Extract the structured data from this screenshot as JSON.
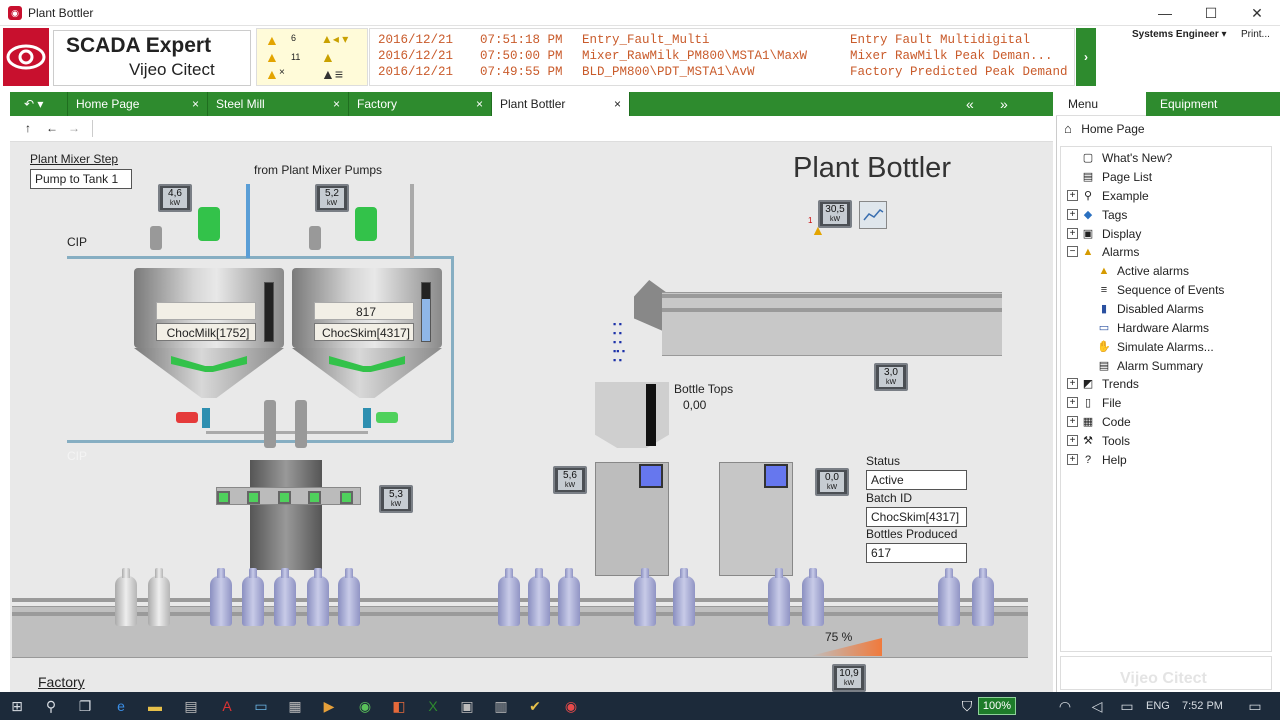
{
  "window": {
    "title": "Plant Bottler",
    "min": "—",
    "max": "☐",
    "close": "✕"
  },
  "header": {
    "brand_line1": "SCADA Expert",
    "brand_line2": "Vijeo Citect",
    "counts": {
      "crit": "6",
      "warn": "11",
      "x": "×"
    },
    "alarms": [
      {
        "date": "2016/12/21",
        "time": "07:51:18 PM",
        "tag": "Entry_Fault_Multi",
        "desc": "Entry Fault Multidigital"
      },
      {
        "date": "2016/12/21",
        "time": "07:50:00 PM",
        "tag": "Mixer_RawMilk_PM800\\MSTA1\\MaxW",
        "desc": "Mixer RawMilk Peak Deman..."
      },
      {
        "date": "2016/12/21",
        "time": "07:49:55 PM",
        "tag": "BLD_PM800\\PDT_MSTA1\\AvW",
        "desc": "Factory Predicted Peak Demand"
      }
    ],
    "next": "›",
    "user": "Systems Engineer",
    "print": "Print..."
  },
  "tabs": [
    {
      "label": "Home Page",
      "close": "×"
    },
    {
      "label": "Steel Mill",
      "close": "×"
    },
    {
      "label": "Factory",
      "close": "×"
    },
    {
      "label": "Plant Bottler",
      "close": "×"
    }
  ],
  "tabnav": {
    "back": "↶ ▾",
    "prev": "«",
    "next": "»"
  },
  "nav": {
    "up": "↑",
    "back": "←",
    "fwd": "→"
  },
  "page": {
    "title": "Plant Bottler",
    "mixer_step_label": "Plant Mixer Step",
    "mixer_step_value": "Pump to Tank 1",
    "from_pumps": "from Plant Mixer Pumps",
    "cip_top": "CIP",
    "cip_bottom": "CIP",
    "tank1": {
      "value": "",
      "batch": "ChocMilk[1752]"
    },
    "tank2": {
      "value": "817",
      "batch": "ChocSkim[4317]"
    },
    "bottle_tops_label": "Bottle Tops",
    "bottle_tops_value": "0,00",
    "status_label": "Status",
    "status_value": "Active",
    "batch_label": "Batch ID",
    "batch_value": "ChocSkim[4317]",
    "bottles_label": "Bottles Produced",
    "bottles_value": "617",
    "fill_percent": "75 %",
    "factory_link": "Factory",
    "kw_unit": "kW",
    "alarm_count": "1",
    "meters": {
      "m1": "4,6",
      "m2": "5,2",
      "m3": "30,5",
      "m4": "3,0",
      "m5": "5,3",
      "m6": "5,6",
      "m7": "0,0",
      "m8": "10,9"
    }
  },
  "sidepanel": {
    "tab_menu": "Menu",
    "tab_equipment": "Equipment",
    "home": "Home Page",
    "items": [
      {
        "label": "What's New?"
      },
      {
        "label": "Page List"
      },
      {
        "label": "Example"
      },
      {
        "label": "Tags"
      },
      {
        "label": "Display"
      },
      {
        "label": "Alarms"
      },
      {
        "label": "Active alarms"
      },
      {
        "label": "Sequence of Events"
      },
      {
        "label": "Disabled Alarms"
      },
      {
        "label": "Hardware Alarms"
      },
      {
        "label": "Simulate Alarms..."
      },
      {
        "label": "Alarm Summary"
      },
      {
        "label": "Trends"
      },
      {
        "label": "File"
      },
      {
        "label": "Code"
      },
      {
        "label": "Tools"
      },
      {
        "label": "Help"
      }
    ],
    "watermark": "Vijeo Citect"
  },
  "taskbar": {
    "battery": "100%",
    "lang": "ENG",
    "time": "7:52 PM"
  },
  "colors": {
    "green": "#2e8b2e",
    "alarm_text": "#c95b2b",
    "brand_red": "#c8102e"
  }
}
